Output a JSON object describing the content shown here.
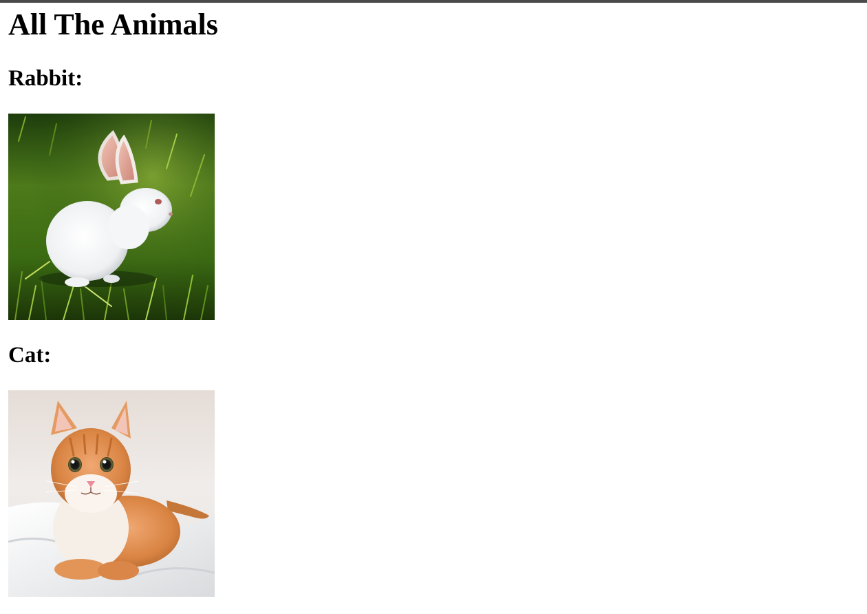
{
  "page": {
    "title": "All The Animals"
  },
  "sections": [
    {
      "heading": "Rabbit:",
      "image_subject": "white rabbit sitting in green grass"
    },
    {
      "heading": "Cat:",
      "image_subject": "orange tabby cat lying on white blanket"
    }
  ],
  "colors": {
    "top_border": "#4a4a4a",
    "background": "#ffffff",
    "text": "#000000"
  }
}
